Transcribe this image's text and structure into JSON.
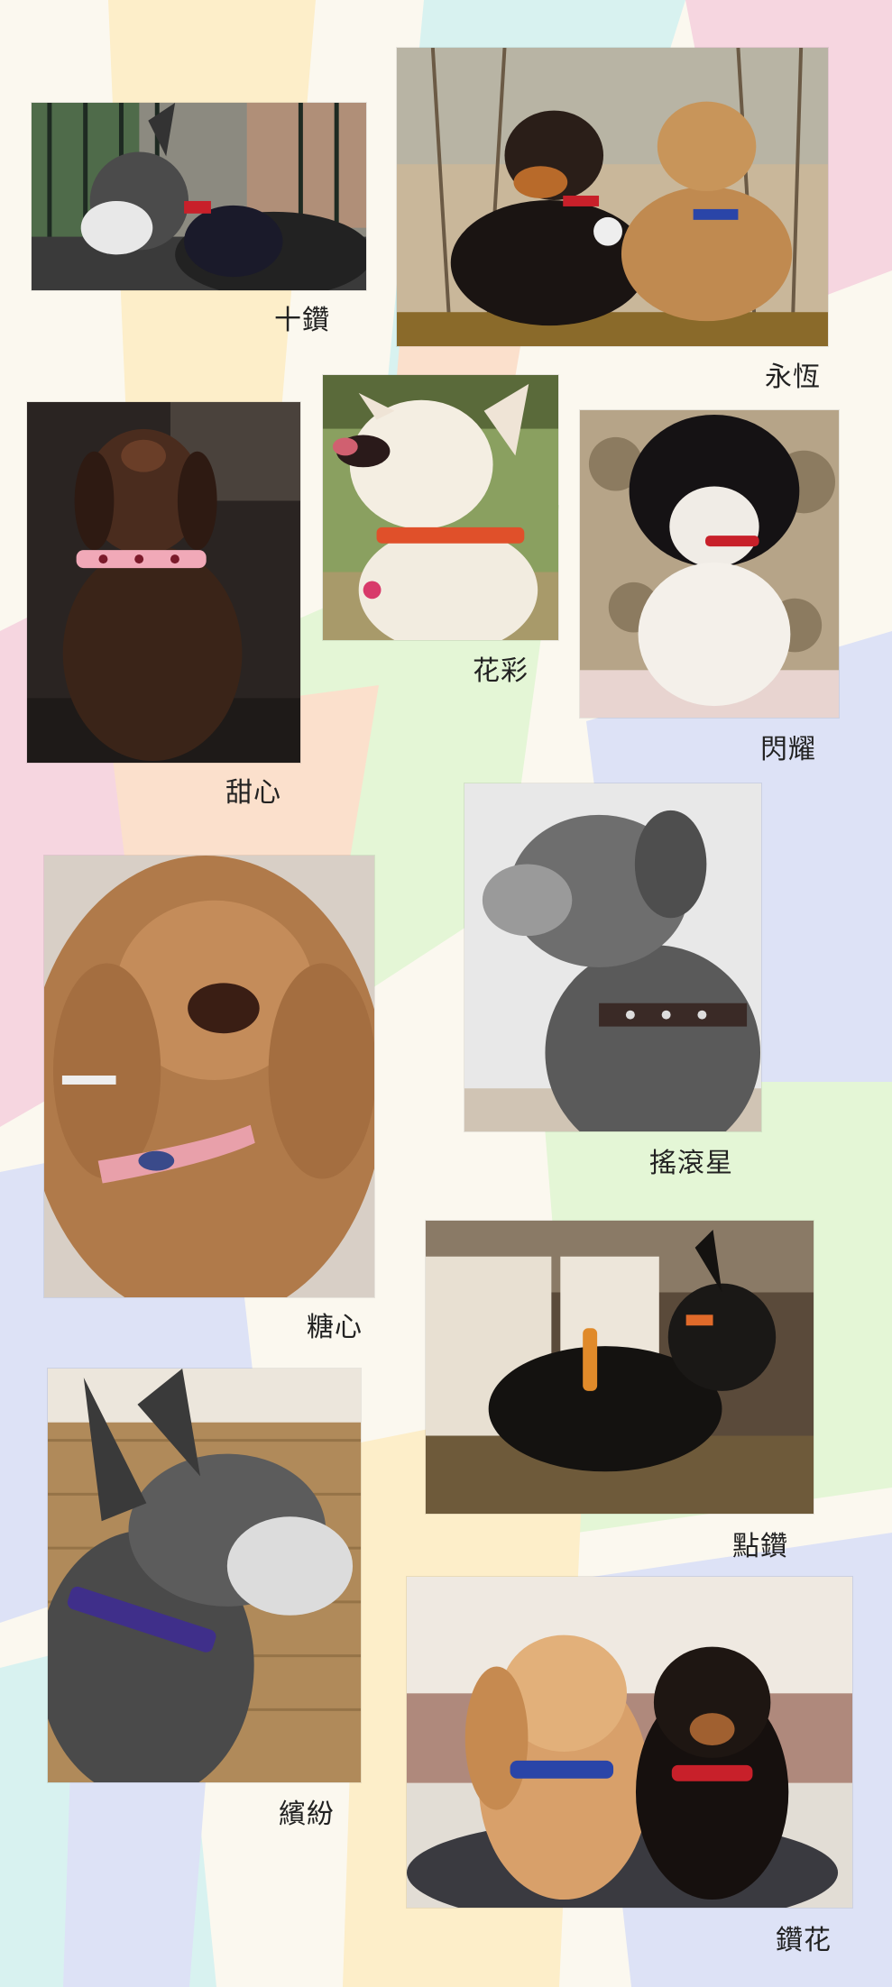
{
  "collars": [
    {
      "id": "shizuan",
      "caption": "十鑽"
    },
    {
      "id": "yongheng",
      "caption": "永恆"
    },
    {
      "id": "tianxin",
      "caption": "甜心"
    },
    {
      "id": "huacai",
      "caption": "花彩"
    },
    {
      "id": "shanyao",
      "caption": "閃耀"
    },
    {
      "id": "yaogunxing",
      "caption": "搖滾星"
    },
    {
      "id": "tangxin",
      "caption": "糖心"
    },
    {
      "id": "dianzuan",
      "caption": "點鑽"
    },
    {
      "id": "binfen",
      "caption": "繽紛"
    },
    {
      "id": "zuanhua",
      "caption": "鑽花"
    }
  ],
  "colors": {
    "background_pastels": [
      "#fdeec9",
      "#d8f2f0",
      "#f6d6e0",
      "#dde2f6",
      "#e4f6d6",
      "#fbe0cc"
    ],
    "collar_red": "#c8202a",
    "collar_pink": "#f1a9b8",
    "collar_blue": "#2a45a8",
    "collar_purple": "#3f2f8a",
    "collar_orange": "#e08a2a",
    "collar_black": "#3a2a26"
  }
}
